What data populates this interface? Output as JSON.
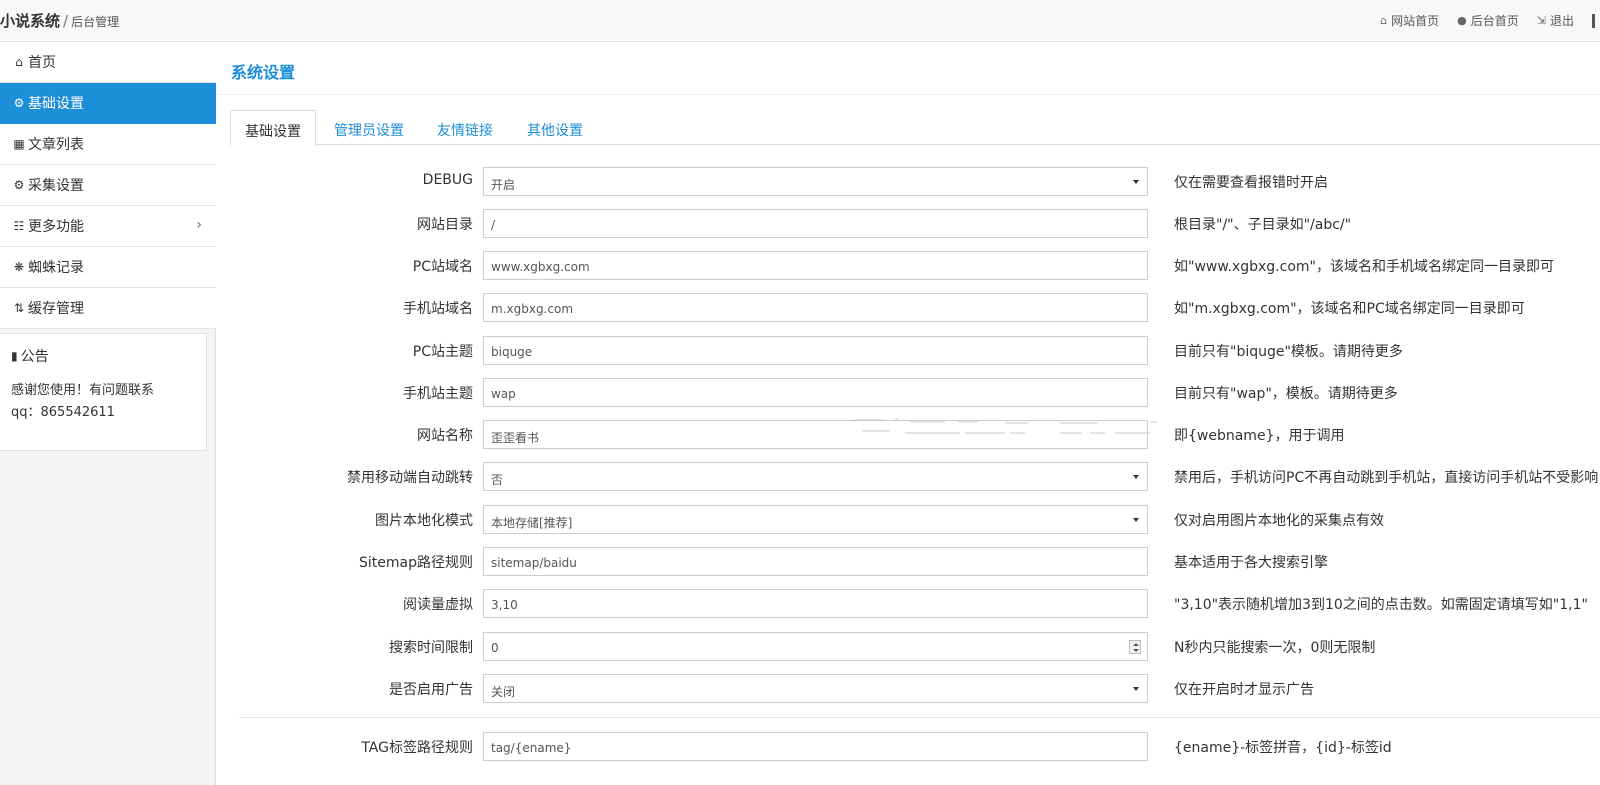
{
  "header": {
    "brand_main": "小说系统",
    "brand_sep": "/",
    "brand_sub": "后台管理",
    "nav": [
      {
        "label": "网站首页",
        "icon": "home-icon"
      },
      {
        "label": "后台首页",
        "icon": "user-icon"
      },
      {
        "label": "退出",
        "icon": "sign-out-icon"
      }
    ]
  },
  "sidebar": {
    "items": [
      {
        "label": "首页",
        "icon": "home-icon"
      },
      {
        "label": "基础设置",
        "icon": "gear-icon",
        "active": true
      },
      {
        "label": "文章列表",
        "icon": "table-icon"
      },
      {
        "label": "采集设置",
        "icon": "gears-icon"
      },
      {
        "label": "更多功能",
        "icon": "sitemap-icon",
        "has_submenu": true
      },
      {
        "label": "蜘蛛记录",
        "icon": "bug-icon"
      },
      {
        "label": "缓存管理",
        "icon": "retweet-icon"
      }
    ],
    "notice": {
      "title": "公告",
      "line1": "感谢您使用！有问题联系",
      "line2": "qq：865542611"
    }
  },
  "main": {
    "title": "系统设置",
    "tabs": [
      {
        "label": "基础设置",
        "active": true
      },
      {
        "label": "管理员设置"
      },
      {
        "label": "友情链接"
      },
      {
        "label": "其他设置"
      }
    ],
    "fields": [
      {
        "label": "DEBUG",
        "type": "select",
        "value": "开启",
        "help": "仅在需要查看报错时开启"
      },
      {
        "label": "网站目录",
        "type": "text",
        "value": "/",
        "help": "根目录\"/\"、子目录如\"/abc/\""
      },
      {
        "label": "PC站域名",
        "type": "text",
        "value": "www.xgbxg.com",
        "help": "如\"www.xgbxg.com\"，该域名和手机域名绑定同一目录即可"
      },
      {
        "label": "手机站域名",
        "type": "text",
        "value": "m.xgbxg.com",
        "help": "如\"m.xgbxg.com\"，该域名和PC域名绑定同一目录即可"
      },
      {
        "label": "PC站主题",
        "type": "text",
        "value": "biquge",
        "help": "目前只有\"biquge\"模板。请期待更多"
      },
      {
        "label": "手机站主题",
        "type": "text",
        "value": "wap",
        "help": "目前只有\"wap\"，模板。请期待更多"
      },
      {
        "label": "网站名称",
        "type": "text",
        "value": "歪歪看书",
        "help": "即{webname}，用于调用"
      },
      {
        "label": "禁用移动端自动跳转",
        "type": "select",
        "value": "否",
        "help": "禁用后，手机访问PC不再自动跳到手机站，直接访问手机站不受影响"
      },
      {
        "label": "图片本地化模式",
        "type": "select",
        "value": "本地存储[推荐]",
        "help": "仅对启用图片本地化的采集点有效"
      },
      {
        "label": "Sitemap路径规则",
        "type": "text",
        "value": "sitemap/baidu",
        "help": "基本适用于各大搜索引擎"
      },
      {
        "label": "阅读量虚拟",
        "type": "text",
        "value": "3,10",
        "help": "\"3,10\"表示随机增加3到10之间的点击数。如需固定请填写如\"1,1\""
      },
      {
        "label": "搜索时间限制",
        "type": "number",
        "value": "0",
        "help": "N秒内只能搜索一次，0则无限制"
      },
      {
        "label": "是否启用广告",
        "type": "select",
        "value": "关闭",
        "help": "仅在开启时才显示广告"
      },
      {
        "label": "TAG标签路径规则",
        "type": "text",
        "value": "tag/{ename}",
        "help": "{ename}-标签拼音，{id}-标签id"
      }
    ]
  },
  "colors": {
    "accent": "#1d8ed8",
    "topbar_bg": "#f8f8f8",
    "sidebar_bg": "#f5f5f5"
  }
}
